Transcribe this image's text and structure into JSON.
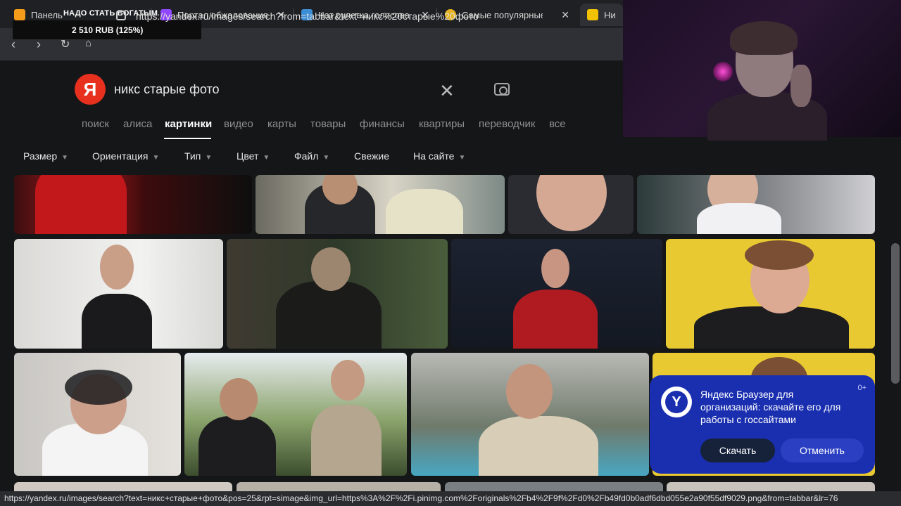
{
  "tabs": [
    {
      "title": "Панель",
      "icon": "donation-alerts-icon",
      "color": "#f59c1a"
    },
    {
      "title": "Портал обжалования -",
      "icon": "twitch-icon",
      "color": "#9146ff"
    },
    {
      "title": "Чат рулетка голосовая",
      "icon": "microphone-icon",
      "color": "#3b8ed6"
    },
    {
      "title": "Самые популярные",
      "icon": "sparkle-icon",
      "color": "#e6b422"
    },
    {
      "title": "Никс",
      "icon": "yandex-images-icon",
      "color": "#f2c100"
    }
  ],
  "donation": {
    "goal_text": "НАДО СТАТЬ БОГАТЫМ",
    "progress_text": "2 510 RUB (125%)"
  },
  "address_bar": {
    "url": "https://yandex.ru/images/search?from=tabbar&text=никс%20старые%20фото"
  },
  "search": {
    "logo_letter": "Я",
    "query": "никс старые фото"
  },
  "services": [
    "поиск",
    "алиса",
    "картинки",
    "видео",
    "карты",
    "товары",
    "финансы",
    "квартиры",
    "переводчик",
    "все"
  ],
  "filters": [
    "Размер",
    "Ориентация",
    "Тип",
    "Цвет",
    "Файл",
    "Свежие",
    "На сайте"
  ],
  "notification": {
    "age_badge": "0+",
    "message": "Яндекс Браузер для организаций: скачайте его для работы с госсайтами",
    "download_label": "Скачать",
    "cancel_label": "Отменить"
  },
  "status_url": "https://yandex.ru/images/search?text=никс+старые+фото&pos=25&rpt=simage&img_url=https%3A%2F%2Fi.pinimg.com%2Foriginals%2Fb4%2F9f%2Fd0%2Fb49fd0b0adf6dbd055e2a90f55df9029.png&from=tabbar&lr=76",
  "colors": {
    "yandex_red": "#e7301e",
    "notification_blue": "#1a2fb0",
    "background": "#151618"
  }
}
